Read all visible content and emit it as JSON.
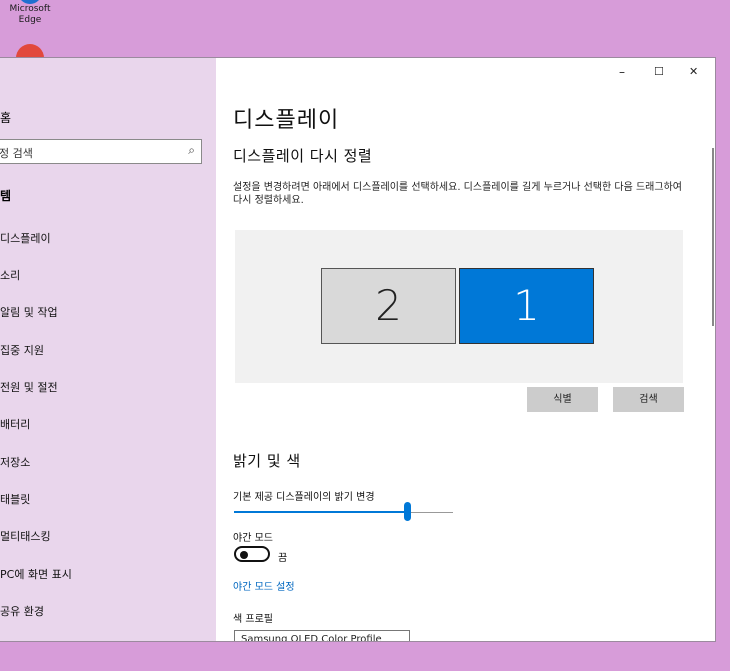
{
  "desktop": {
    "edge_label": "Microsoft Edge"
  },
  "sidebar": {
    "home": "홈",
    "search_placeholder": "정 검색",
    "section": "템",
    "items": [
      {
        "label": "디스플레이"
      },
      {
        "label": "소리"
      },
      {
        "label": "알림 및 작업"
      },
      {
        "label": "집중 지원"
      },
      {
        "label": "전원 및 절전"
      },
      {
        "label": "배터리"
      },
      {
        "label": "저장소"
      },
      {
        "label": "태블릿"
      },
      {
        "label": "멀티태스킹"
      },
      {
        "label": "PC에 화면 표시"
      },
      {
        "label": "공유 환경"
      }
    ]
  },
  "titlebar": {
    "minimize": "–",
    "maximize": "☐",
    "close": "✕"
  },
  "main": {
    "title": "디스플레이",
    "rearrange_heading": "디스플레이 다시 정렬",
    "rearrange_desc": "설정을 변경하려면 아래에서 디스플레이를 선택하세요. 디스플레이를 길게 누르거나 선택한 다음 드래그하여 다시 정렬하세요.",
    "monitor_2": "2",
    "monitor_1": "1",
    "identify_button": "식별",
    "detect_button": "검색",
    "brightness_heading": "밝기 및 색",
    "brightness_label": "기본 제공 디스플레이의 밝기 변경",
    "brightness_value": 0.79,
    "night_light_label": "야간 모드",
    "night_light_state": "끔",
    "night_light_settings_link": "야간 모드 설정",
    "color_profile_label": "색 프로필",
    "color_profile_value": "Samsung OLED Color Profile"
  },
  "colors": {
    "accent": "#0078d7",
    "desktop_bg": "#d79cd9",
    "sidebar_bg": "#e9d6ec"
  }
}
